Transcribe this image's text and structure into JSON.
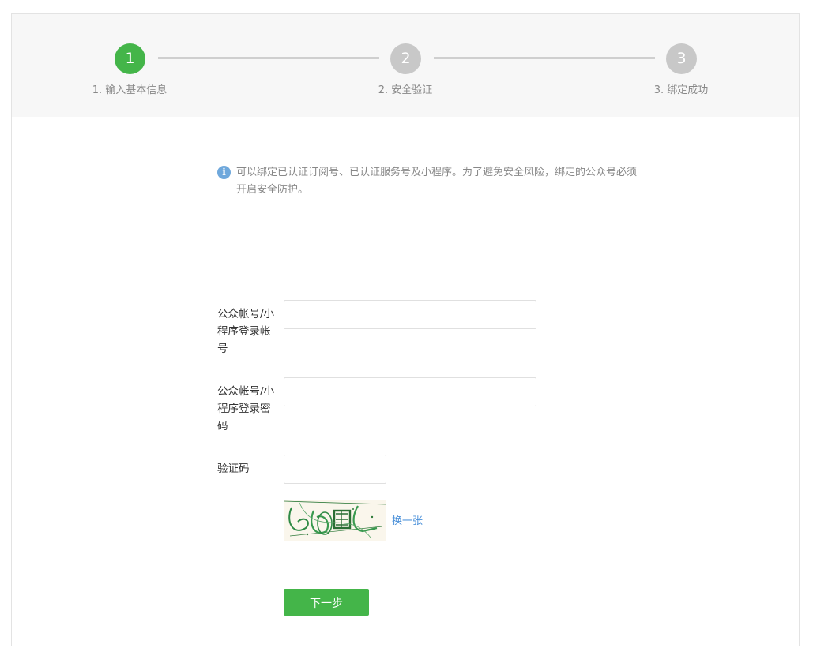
{
  "steps": [
    {
      "number": "1",
      "label": "1. 输入基本信息",
      "state": "active"
    },
    {
      "number": "2",
      "label": "2. 安全验证",
      "state": "inactive"
    },
    {
      "number": "3",
      "label": "3. 绑定成功",
      "state": "inactive"
    }
  ],
  "notice": {
    "icon": "info-icon",
    "icon_glyph": "i",
    "text": "可以绑定已认证订阅号、已认证服务号及小程序。为了避免安全风险，绑定的公众号必须开启安全防护。"
  },
  "form": {
    "account": {
      "label": "公众帐号/小程序登录帐号",
      "value": "",
      "placeholder": ""
    },
    "password": {
      "label": "公众帐号/小程序登录密码",
      "value": "",
      "placeholder": ""
    },
    "captcha": {
      "label": "验证码",
      "value": "",
      "placeholder": ""
    },
    "refresh_label": "换一张",
    "next_label": "下一步"
  },
  "colors": {
    "accent": "#44b549",
    "inactive_step": "#c8c8c8",
    "link": "#4a90d9",
    "info": "#6fa8dc"
  }
}
